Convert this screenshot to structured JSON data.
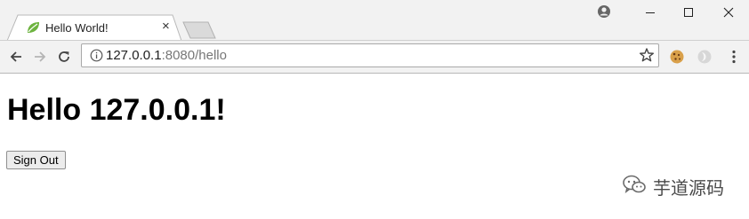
{
  "tab": {
    "title": "Hello World!",
    "close": "×"
  },
  "address_bar": {
    "host": "127.0.0.1",
    "rest": ":8080/hello"
  },
  "page": {
    "heading": "Hello 127.0.0.1!",
    "sign_out_label": "Sign Out"
  },
  "watermark": {
    "text": "芋道源码"
  },
  "icons": {
    "favicon": "leaf-icon",
    "profile": "profile-icon",
    "back": "arrow-left-icon",
    "forward": "arrow-right-icon",
    "reload": "reload-icon",
    "info": "info-icon",
    "bookmark": "star-icon",
    "extension1": "cookie-icon",
    "extension2": "extension-icon",
    "menu": "kebab-menu-icon",
    "watermark_logo": "wechat-icon"
  },
  "colors": {
    "accent_leaf": "#6db33f",
    "chrome_bg": "#f2f2f2"
  }
}
